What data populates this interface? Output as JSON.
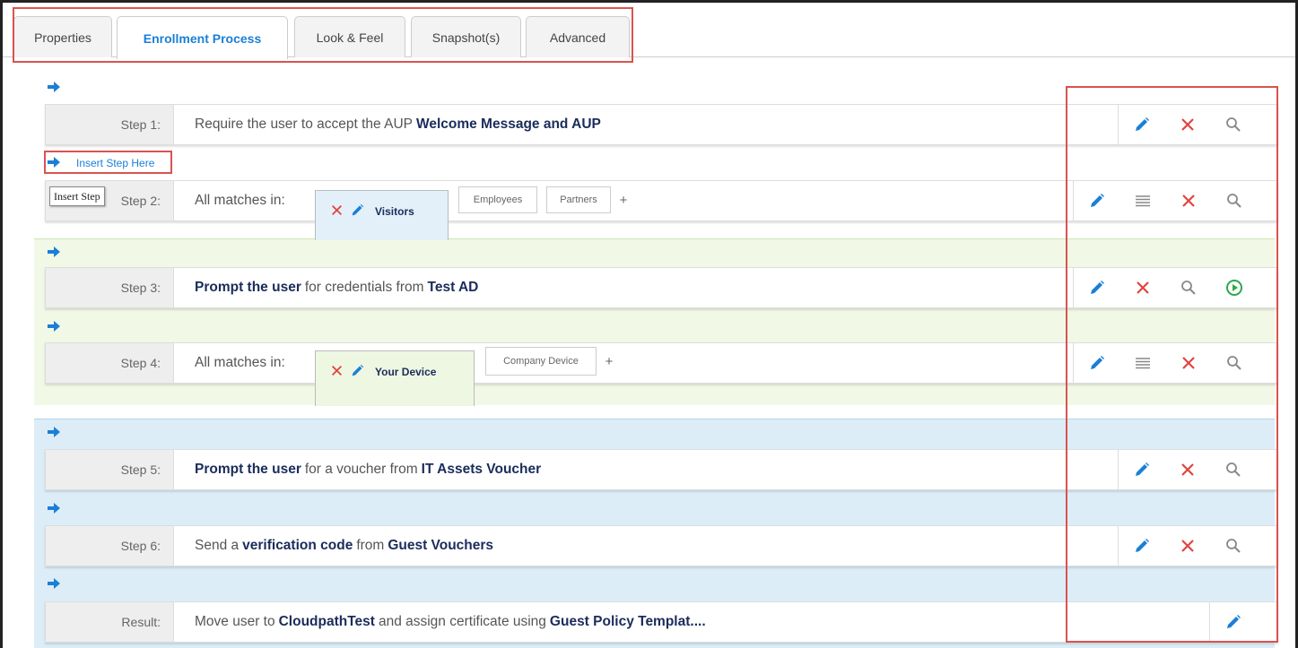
{
  "tabs": [
    "Properties",
    "Enrollment Process",
    "Look & Feel",
    "Snapshot(s)",
    "Advanced"
  ],
  "active_tab": "Enrollment Process",
  "insert_step_link": "Insert Step Here",
  "tooltip": "Insert Step",
  "steps": [
    {
      "label": "Step 1:",
      "parts": [
        {
          "t": "Require the user to accept the AUP",
          "b": false
        },
        {
          "t": "Welcome Message and AUP",
          "b": true
        }
      ]
    },
    {
      "label": "Step 2:",
      "parts": [
        {
          "t": "All matches in:",
          "b": false
        }
      ],
      "segments": {
        "active": "Visitors",
        "others": [
          "Employees",
          "Partners"
        ],
        "add": "+"
      }
    },
    {
      "label": "Step 3:",
      "parts": [
        {
          "t": "Prompt the user",
          "b": true
        },
        {
          "t": "for credentials from",
          "b": false
        },
        {
          "t": "Test AD",
          "b": true
        }
      ]
    },
    {
      "label": "Step 4:",
      "parts": [
        {
          "t": "All matches in:",
          "b": false
        }
      ],
      "segments": {
        "active": "Your Device",
        "others": [
          "Company Device"
        ],
        "add": "+"
      }
    },
    {
      "label": "Step 5:",
      "parts": [
        {
          "t": "Prompt the user",
          "b": true
        },
        {
          "t": "for a voucher from",
          "b": false
        },
        {
          "t": "IT Assets Voucher",
          "b": true
        }
      ]
    },
    {
      "label": "Step 6:",
      "parts": [
        {
          "t": "Send a",
          "b": false
        },
        {
          "t": "verification code",
          "b": true
        },
        {
          "t": "from",
          "b": false
        },
        {
          "t": "Guest Vouchers",
          "b": true
        }
      ]
    },
    {
      "label": "Result:",
      "parts": [
        {
          "t": "Move user to",
          "b": false
        },
        {
          "t": "CloudpathTest",
          "b": true
        },
        {
          "t": "and assign certificate using",
          "b": false
        },
        {
          "t": "Guest Policy Templat....",
          "b": true
        }
      ]
    }
  ],
  "colors": {
    "accent": "#1a7fd6",
    "delete": "#e0443e",
    "green_band": "#f1f8e6",
    "blue_band": "#dcedf8",
    "highlight": "#d9534f",
    "play": "#2da84a"
  },
  "icons": [
    "arrow-right-icon",
    "pencil-icon",
    "close-icon",
    "search-icon",
    "menu-icon",
    "play-circle-icon"
  ]
}
